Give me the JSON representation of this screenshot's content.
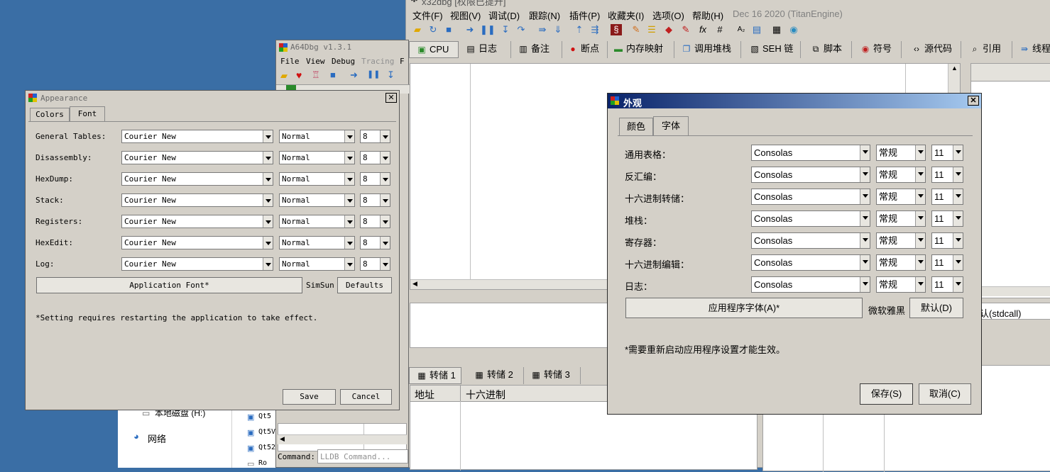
{
  "x32": {
    "title": "x32dbg [权限已提升]",
    "menu": [
      "文件(F)",
      "视图(V)",
      "调试(D)",
      "跟踪(N)",
      "插件(P)",
      "收藏夹(I)",
      "选项(O)",
      "帮助(H)"
    ],
    "build": "Dec 16 2020 (TitanEngine)",
    "tabs": [
      "CPU",
      "日志",
      "备注",
      "断点",
      "内存映射",
      "调用堆栈",
      "SEH 链",
      "脚本",
      "符号",
      "源代码",
      "引用",
      "线程"
    ],
    "dump_tabs": [
      "转储 1",
      "转储 2",
      "转储 3"
    ],
    "dump_headers": [
      "地址",
      "十六进制"
    ],
    "callconv": "认(stdcall)"
  },
  "a64": {
    "title": "A64Dbg v1.3.1",
    "menu": [
      "File",
      "View",
      "Debug",
      "Tracing",
      "F"
    ],
    "tree_items": [
      "本地磁盘 (H:)",
      "网络"
    ],
    "files": [
      "Qt5",
      "Qt5V",
      "Qt52",
      "Ro"
    ],
    "command_label": "Command:",
    "command_placeholder": "LLDB Command..."
  },
  "appearance": {
    "title": "Appearance",
    "tabs": [
      "Colors",
      "Font"
    ],
    "rows": [
      {
        "label": "General Tables:",
        "font": "Courier New",
        "style": "Normal",
        "size": "8"
      },
      {
        "label": "Disassembly:",
        "font": "Courier New",
        "style": "Normal",
        "size": "8"
      },
      {
        "label": "HexDump:",
        "font": "Courier New",
        "style": "Normal",
        "size": "8"
      },
      {
        "label": "Stack:",
        "font": "Courier New",
        "style": "Normal",
        "size": "8"
      },
      {
        "label": "Registers:",
        "font": "Courier New",
        "style": "Normal",
        "size": "8"
      },
      {
        "label": "HexEdit:",
        "font": "Courier New",
        "style": "Normal",
        "size": "8"
      },
      {
        "label": "Log:",
        "font": "Courier New",
        "style": "Normal",
        "size": "8"
      }
    ],
    "app_font_button": "Application Font*",
    "app_font_value": "SimSun",
    "defaults_button": "Defaults",
    "note": "*Setting requires restarting the application to take effect.",
    "save_button": "Save",
    "cancel_button": "Cancel"
  },
  "waiguan": {
    "title": "外观",
    "tabs": [
      "颜色",
      "字体"
    ],
    "rows": [
      {
        "label": "通用表格：",
        "font": "Consolas",
        "style": "常规",
        "size": "11"
      },
      {
        "label": "反汇编：",
        "font": "Consolas",
        "style": "常规",
        "size": "11"
      },
      {
        "label": "十六进制转储：",
        "font": "Consolas",
        "style": "常规",
        "size": "11"
      },
      {
        "label": "堆栈：",
        "font": "Consolas",
        "style": "常规",
        "size": "11"
      },
      {
        "label": "寄存器：",
        "font": "Consolas",
        "style": "常规",
        "size": "11"
      },
      {
        "label": "十六进制编辑：",
        "font": "Consolas",
        "style": "常规",
        "size": "11"
      },
      {
        "label": "日志：",
        "font": "Consolas",
        "style": "常规",
        "size": "11"
      }
    ],
    "app_font_button": "应用程序字体(A)*",
    "app_font_value": "微软雅黑",
    "defaults_button": "默认(D)",
    "note": "*需要重新启动应用程序设置才能生效。",
    "save_button": "保存(S)",
    "cancel_button": "取消(C)"
  },
  "colors": {
    "desktop": "#3a6ea5",
    "window_face": "#d4d0c8",
    "title_active_start": "#0a246a",
    "title_active_end": "#a6caf0"
  }
}
